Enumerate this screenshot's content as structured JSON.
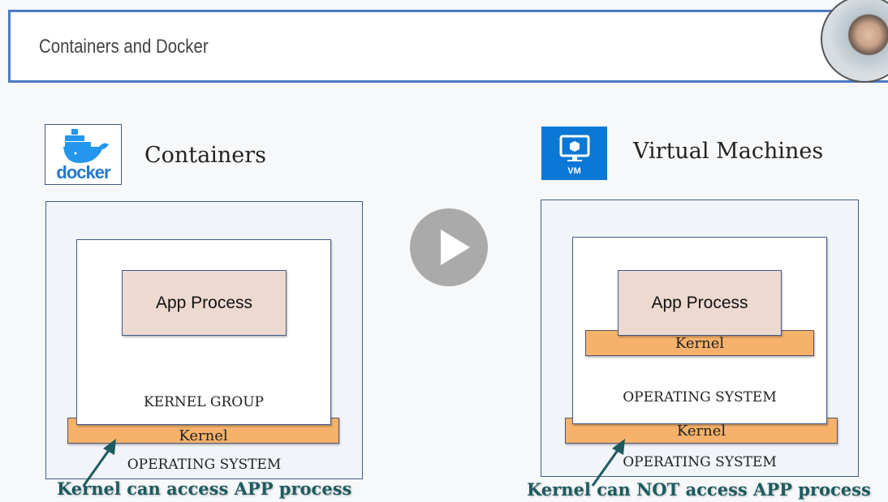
{
  "header": {
    "title": "Containers and Docker"
  },
  "left": {
    "heading": "Containers",
    "logo_text": "docker",
    "app": "App Process",
    "group": "KERNEL GROUP",
    "kernel": "Kernel",
    "os": "OPERATING SYSTEM",
    "caption": "Kernel can access APP process"
  },
  "right": {
    "heading": "Virtual Machines",
    "logo_text": "VM",
    "app": "App Process",
    "kernel_inner": "Kernel",
    "os_inner": "OPERATING SYSTEM",
    "kernel": "Kernel",
    "os": "OPERATING SYSTEM",
    "caption": "Kernel can NOT access APP process"
  },
  "colors": {
    "accent": "#4a7bc3",
    "kernel": "#f6b26b",
    "app": "#eed9d1",
    "caption": "#1d5b5f",
    "vm": "#0a78d4"
  }
}
